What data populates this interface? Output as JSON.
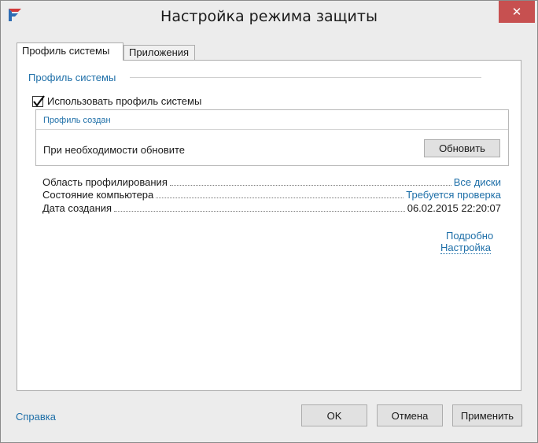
{
  "window": {
    "title": "Настройка режима защиты",
    "close_label": "✕",
    "accent_close": "#c75050",
    "link_color": "#1e6fa8"
  },
  "tabs": [
    {
      "label": "Профиль системы",
      "active": true
    },
    {
      "label": "Приложения",
      "active": false
    }
  ],
  "profile": {
    "section_title": "Профиль системы",
    "use_profile_label": "Использовать профиль системы",
    "use_profile_checked": true,
    "created_label": "Профиль создан",
    "update_hint": "При необходимости обновите",
    "update_button": "Обновить"
  },
  "info": [
    {
      "label": "Область профилирования",
      "value": "Все диски",
      "is_link": true
    },
    {
      "label": "Состояние компьютера",
      "value": "Требуется проверка",
      "is_link": true
    },
    {
      "label": "Дата создания",
      "value": "06.02.2015 22:20:07",
      "is_link": false
    }
  ],
  "links": {
    "details": "Подробно",
    "settings": "Настройка"
  },
  "footer": {
    "help": "Справка",
    "ok": "OK",
    "cancel": "Отмена",
    "apply": "Применить"
  }
}
